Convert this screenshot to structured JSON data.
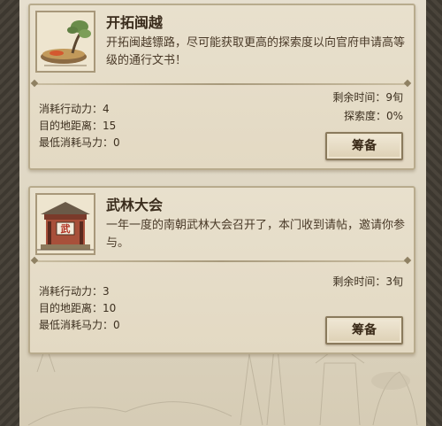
{
  "expeditions": [
    {
      "title": "开拓闽越",
      "description": "开拓闽越镖路，尽可能获取更高的探索度以向官府申请高等级的通行文书！",
      "stats": [
        {
          "label": "消耗行动力",
          "value": "4"
        },
        {
          "label": "目的地距离",
          "value": "15"
        },
        {
          "label": "最低消耗马力",
          "value": "0"
        }
      ],
      "stat_lines": [
        "消耗行动力：4",
        "目的地距离：15",
        "最低消耗马力：0"
      ],
      "remaining_time": "剩余时间：9旬",
      "exploration": "探索度：0%",
      "button_label": "筹备",
      "thumbnail_icon": "bonsai-tree-icon"
    },
    {
      "title": "武林大会",
      "description": "一年一度的南朝武林大会召开了，本门收到请帖，邀请你参与。",
      "stats": [
        {
          "label": "消耗行动力",
          "value": "3"
        },
        {
          "label": "目的地距离",
          "value": "10"
        },
        {
          "label": "最低消耗马力",
          "value": "0"
        }
      ],
      "stat_lines": [
        "消耗行动力：3",
        "目的地距离：10",
        "最低消耗马力：0"
      ],
      "remaining_time": "剩余时间：3旬",
      "button_label": "筹备",
      "thumbnail_icon": "martial-arena-icon",
      "thumbnail_plaque": "武"
    }
  ],
  "colors": {
    "card_bg": "#e6ddc8",
    "card_border": "#b8ab8d",
    "text_dark": "#3a2c1c",
    "button_bg": "#e8dcc2"
  }
}
